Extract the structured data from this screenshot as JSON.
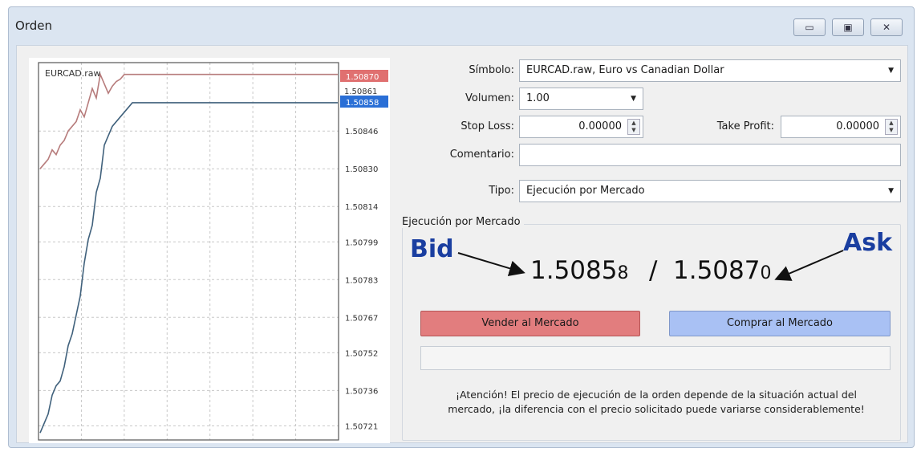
{
  "window": {
    "title": "Orden",
    "controls": [
      "▭",
      "▣",
      "✕"
    ]
  },
  "chart": {
    "symbol": "EURCAD.raw",
    "price_tags": {
      "ask": "1.50870",
      "bid": "1.50858",
      "overlap": "1.50861"
    },
    "colors": {
      "ask": "#e07070",
      "bid": "#2a6fd6",
      "ask_line": "#b77c7c",
      "bid_line": "#40617c"
    }
  },
  "chart_data": {
    "type": "line",
    "ylim": [
      1.50715,
      1.50875
    ],
    "y_ticks": [
      "1.50846",
      "1.50830",
      "1.50814",
      "1.50799",
      "1.50783",
      "1.50767",
      "1.50752",
      "1.50736",
      "1.50721"
    ],
    "series": [
      {
        "values": [
          1.5083,
          1.50832,
          1.50834,
          1.50838,
          1.50836,
          1.5084,
          1.50842,
          1.50846,
          1.50848,
          1.5085,
          1.50855,
          1.50852,
          1.50858,
          1.50864,
          1.5086,
          1.5087,
          1.50866,
          1.50862,
          1.50865,
          1.50867,
          1.50868,
          1.5087,
          1.5087,
          1.5087,
          1.5087
        ]
      },
      {
        "values": [
          1.50718,
          1.50722,
          1.50726,
          1.50734,
          1.50738,
          1.5074,
          1.50746,
          1.50755,
          1.5076,
          1.50768,
          1.50776,
          1.5079,
          1.508,
          1.50806,
          1.5082,
          1.50826,
          1.5084,
          1.50844,
          1.50848,
          1.5085,
          1.50852,
          1.50854,
          1.50856,
          1.50858,
          1.50858
        ]
      }
    ]
  },
  "form": {
    "symbol_label": "Símbolo:",
    "symbol_value": "EURCAD.raw, Euro vs Canadian Dollar",
    "volume_label": "Volumen:",
    "volume_value": "1.00",
    "stop_loss_label": "Stop Loss:",
    "stop_loss_value": "0.00000",
    "take_profit_label": "Take Profit:",
    "take_profit_value": "0.00000",
    "comment_label": "Comentario:",
    "comment_value": "",
    "type_label": "Tipo:",
    "type_value": "Ejecución por Mercado"
  },
  "execution": {
    "group_title": "Ejecución por Mercado",
    "bid_main": "1.5085",
    "bid_last": "8",
    "separator": "/",
    "ask_main": "1.5087",
    "ask_last": "0",
    "bid_annotation": "Bid",
    "ask_annotation": "Ask",
    "sell_label": "Vender al Mercado",
    "buy_label": "Comprar al Mercado",
    "warning_line1": "¡Atención! El precio de ejecución de la orden depende de la situación actual del",
    "warning_line2": "mercado, ¡la diferencia con el precio solicitado puede variarse considerablemente!"
  }
}
